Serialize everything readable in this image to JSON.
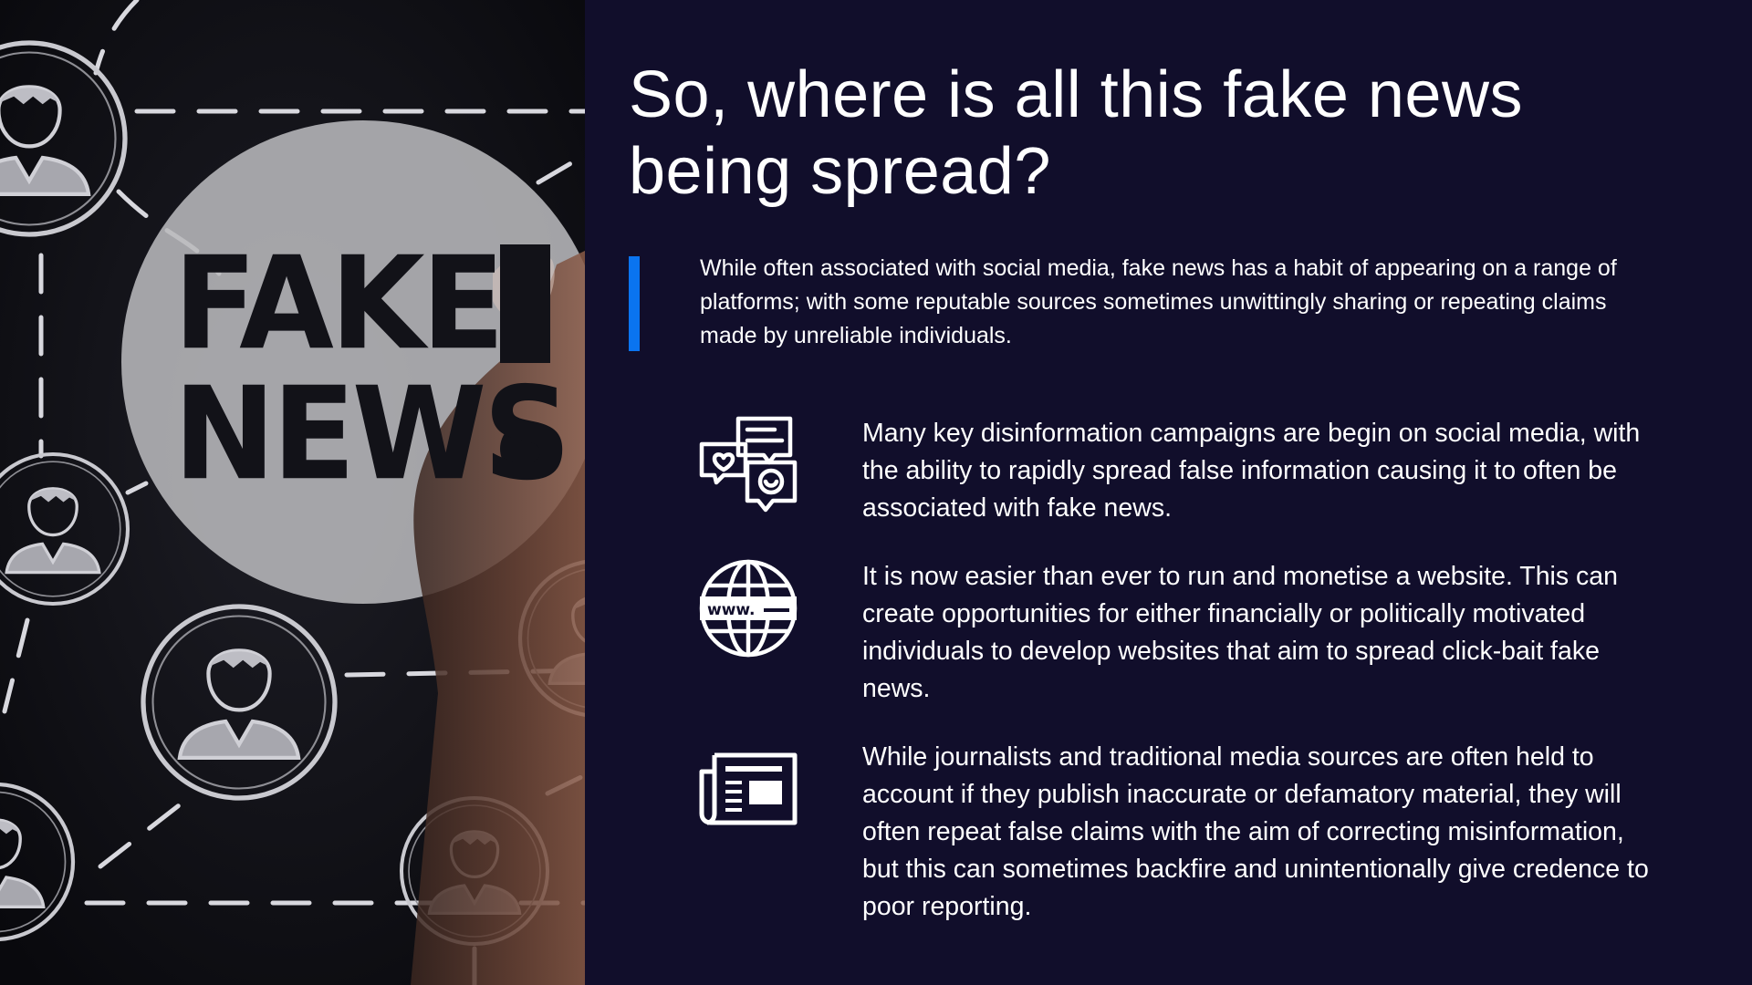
{
  "photo": {
    "word_fake": "FAKE",
    "word_news": "NEWS"
  },
  "slide": {
    "title": "So, where is all this fake news being spread?",
    "intro": "While often associated with social media, fake news has a habit of appearing on a range of platforms; with some reputable sources sometimes unwittingly sharing or repeating claims made by unreliable individuals.",
    "accent_color": "#0a74f0",
    "background_color": "#110e2b"
  },
  "features": [
    {
      "icon": "social-media-chat-icon",
      "text": "Many key disinformation campaigns are begin on social media, with the ability to rapidly spread false information causing it to often be associated with fake news."
    },
    {
      "icon": "globe-www-icon",
      "globe_label": "www.",
      "text": "It is now easier than ever to run and monetise a website. This can create opportunities for either financially or politically motivated individuals to develop websites that aim to spread click-bait fake news."
    },
    {
      "icon": "newspaper-icon",
      "text": "While journalists and traditional media sources are often held to account if they publish inaccurate or defamatory material, they will often repeat false claims with the aim of correcting misinformation, but this can sometimes backfire and unintentionally give credence to poor reporting."
    }
  ]
}
